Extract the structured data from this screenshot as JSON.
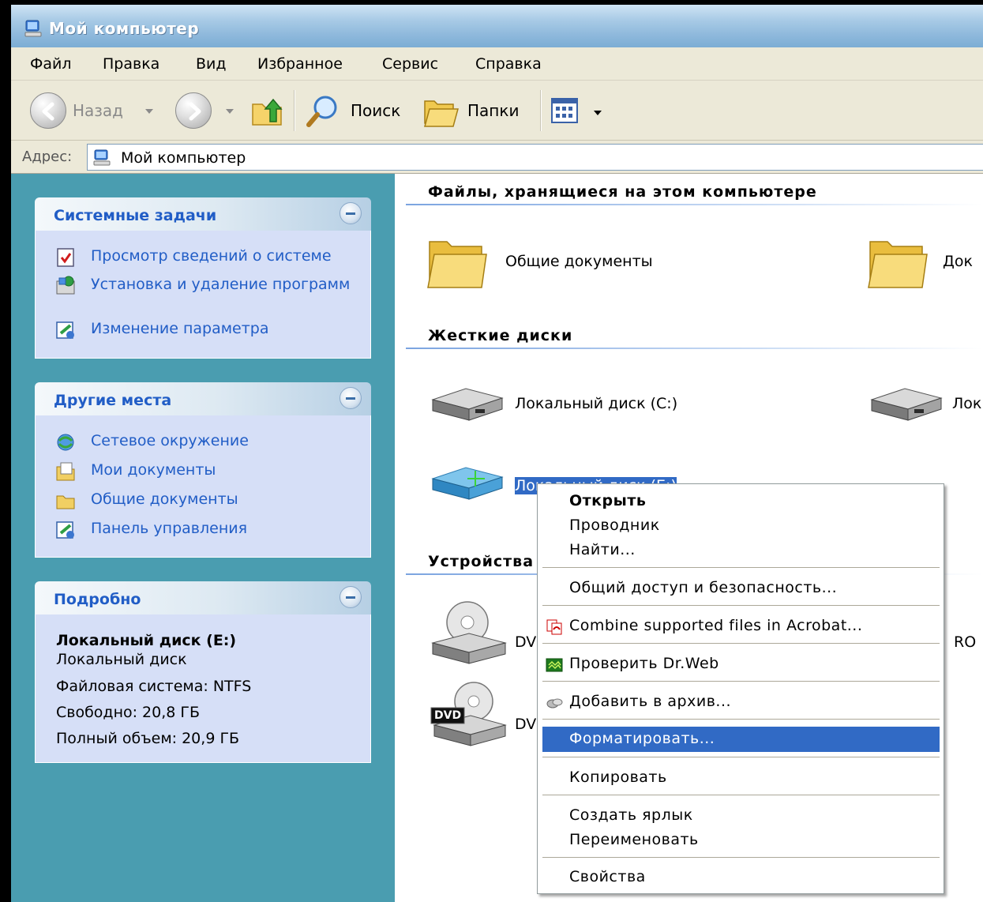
{
  "window": {
    "title": "Мой компьютер"
  },
  "menu": [
    "Файл",
    "Правка",
    "Вид",
    "Избранное",
    "Сервис",
    "Справка"
  ],
  "toolbar": {
    "back": "Назад",
    "search": "Поиск",
    "folders": "Папки"
  },
  "address": {
    "label": "Адрес:",
    "value": "Мой компьютер"
  },
  "left": {
    "system_tasks": {
      "title": "Системные задачи",
      "items": [
        "Просмотр сведений о системе",
        "Установка и удаление программ",
        "Изменение параметра"
      ]
    },
    "other_places": {
      "title": "Другие места",
      "items": [
        "Сетевое окружение",
        "Мои документы",
        "Общие документы",
        "Панель управления"
      ]
    },
    "details": {
      "title": "Подробно",
      "name": "Локальный диск (E:)",
      "type": "Локальный диск",
      "fs": "Файловая система: NTFS",
      "free": "Свободно: 20,8 ГБ",
      "total": "Полный объем: 20,9 ГБ"
    }
  },
  "main": {
    "section_files": "Файлы, хранящиеся на этом компьютере",
    "shared_docs": "Общие документы",
    "docs_partial": "Док",
    "section_hdd": "Жесткие диски",
    "disk_c": "Локальный диск (C:)",
    "disk_partial": "Лок",
    "disk_e": "Локальный диск (E:)",
    "section_devices": "Устройства",
    "dvd1": "DVD",
    "dvd1_right": "RO",
    "dvd2": "DVD",
    "dvd_badge": "DVD"
  },
  "context_menu": {
    "open": "Открыть",
    "explorer": "Проводник",
    "find": "Найти...",
    "sharing": "Общий доступ и безопасность...",
    "acrobat": "Combine supported files in Acrobat...",
    "drweb": "Проверить Dr.Web",
    "archive": "Добавить в архив...",
    "format": "Форматировать...",
    "copy": "Копировать",
    "shortcut": "Создать ярлык",
    "rename": "Переименовать",
    "properties": "Свойства"
  },
  "colors": {
    "accent": "#316ac5",
    "sidebar": "#4a9db0",
    "link": "#215dc6"
  }
}
